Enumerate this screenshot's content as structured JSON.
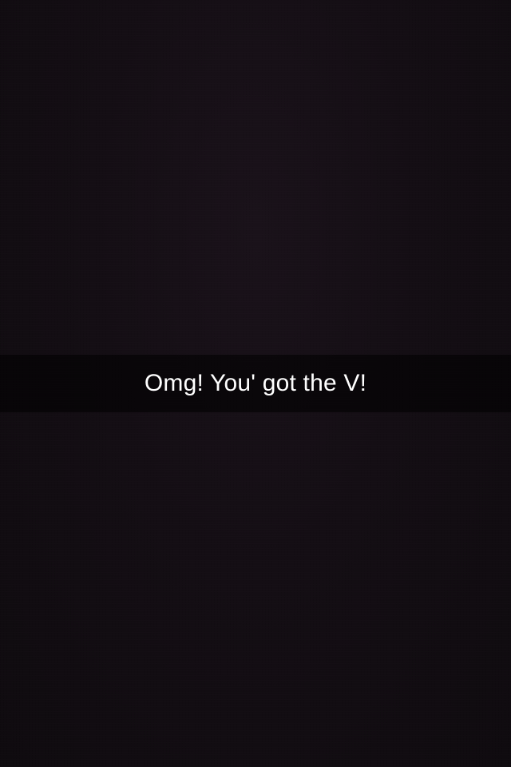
{
  "snap": {
    "caption": "Omg! You' got the V!"
  },
  "colors": {
    "background": "#120d12",
    "caption_bar": "#000000",
    "caption_text": "#ffffff"
  }
}
